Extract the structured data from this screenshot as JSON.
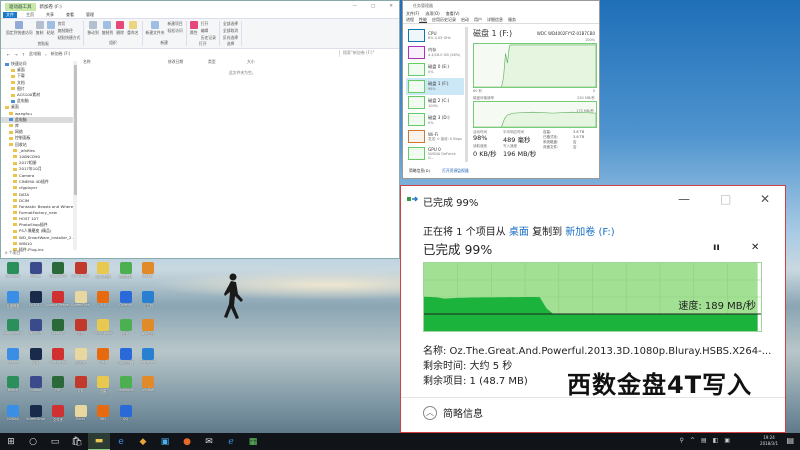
{
  "explorer": {
    "context_tab": "驱动器工具",
    "title": "新加卷 (F:)",
    "tabs": [
      "文件",
      "主页",
      "共享",
      "查看",
      "管理"
    ],
    "ribbon_groups": [
      {
        "name": "剪贴板",
        "buttons": [
          "固定到快速访问",
          "复制",
          "粘贴"
        ],
        "small": [
          "剪切",
          "复制路径",
          "粘贴快捷方式"
        ]
      },
      {
        "name": "组织",
        "buttons": [
          "移动到",
          "复制到",
          "删除",
          "重命名"
        ],
        "small": []
      },
      {
        "name": "新建",
        "buttons": [
          "新建文件夹"
        ],
        "small": [
          "新建项目",
          "轻松访问"
        ]
      },
      {
        "name": "打开",
        "buttons": [
          "属性"
        ],
        "small": [
          "打开",
          "编辑",
          "历史记录"
        ]
      },
      {
        "name": "选择",
        "buttons": [],
        "small": [
          "全部选择",
          "全部取消",
          "反向选择"
        ]
      }
    ],
    "address": [
      "此电脑",
      "新加卷 (F:)"
    ],
    "search_placeholder": "搜索\"新加卷 (F:)\"",
    "columns": [
      "名称",
      "修改日期",
      "类型",
      "大小"
    ],
    "empty_text": "此文件夹为空。",
    "tree": [
      "快速访问",
      "桌面",
      "下载",
      "文档",
      "图片",
      "ACS100素材",
      "此电脑",
      "桌面",
      "wangfuu",
      "此电脑",
      "库",
      "网络",
      "控制面板",
      "回收站",
      "_afxfiles",
      "100NCD90",
      "2017相册",
      "2017年10月",
      "Camera",
      "CINEMA 4D插件",
      "cfgplayer",
      "DATA",
      "DCIM",
      "Fantastic Beasts and Where to Fi",
      "FormatFactory_new",
      "HOST 10T",
      "PhotoShop插件",
      "PS人像磨皮 (精品)",
      "WD_SmartWare_Installer_2.4.20",
      "WIN10",
      "插件-Plug-ins"
    ],
    "status": "0 个项目"
  },
  "taskmgr": {
    "title": "任务管理器",
    "menu": [
      "文件(F)",
      "选项(O)",
      "查看(V)"
    ],
    "tabs": [
      "进程",
      "性能",
      "应用历史记录",
      "启动",
      "用户",
      "详细信息",
      "服务"
    ],
    "list": [
      {
        "name": "CPU",
        "value": "6% 4.05 GHz"
      },
      {
        "name": "内存",
        "value": "4.4/16.0 GB (28%)"
      },
      {
        "name": "磁盘 0 (E:)",
        "value": "0%"
      },
      {
        "name": "磁盘 1 (F:)",
        "value": "98%"
      },
      {
        "name": "磁盘 2 (C:)",
        "value": "100%"
      },
      {
        "name": "磁盘 3 (D:)",
        "value": "0%"
      },
      {
        "name": "Wi-Fi",
        "value": "发送: 0 接收: 0 Kbps"
      },
      {
        "name": "GPU 0",
        "value": "NVIDIA GeForce G..."
      }
    ],
    "disk_title": "磁盘 1 (F:)",
    "disk_model": "WDC WD4002FYYZ-01B7CB0",
    "graph1_top": "100%",
    "graph1_left": "60 秒",
    "graph1_right": "0",
    "graph2_label": "磁盘传输速率",
    "graph2_top": "250 MB/秒",
    "graph2_mid": "175 MB/秒",
    "stats": {
      "active_label": "活动时间",
      "active": "98%",
      "resp_label": "平均响应时间",
      "resp": "489 毫秒",
      "read_label": "读取速度",
      "read": "0 KB/秒",
      "write_label": "写入速度",
      "write": "196 MB/秒"
    },
    "props": [
      [
        "容量:",
        "3.6 TB"
      ],
      [
        "已格式化:",
        "3.6 TB"
      ],
      [
        "系统磁盘:",
        "否"
      ],
      [
        "页面文件:",
        "否"
      ]
    ],
    "footer": [
      "简略信息(D)",
      "打开资源监视器"
    ]
  },
  "dialog": {
    "title": "已完成 99%",
    "line_prefix": "正在将 1 个项目从",
    "source": "桌面",
    "line_mid": "复制到",
    "dest": "新加卷 (F:)",
    "progress_text": "已完成 99%",
    "progress": 0.99,
    "speed_label": "速度: 189 MB/秒",
    "name_line": "名称: Oz.The.Great.And.Powerful.2013.3D.1080p.Bluray.HSBS.X264-...",
    "time_line": "剩余时间: 大约 5 秒",
    "items_line": "剩余项目: 1 (48.7 MB)",
    "watermark": "西数金盘4T写入",
    "less_details": "简略信息",
    "speed_max": 756,
    "speed_history": [
      380,
      378,
      372,
      360,
      365,
      368,
      370,
      372,
      372,
      373,
      374,
      375,
      376,
      377,
      377,
      378,
      378,
      377,
      250,
      189,
      189,
      189,
      192,
      194,
      192,
      190,
      189,
      189,
      188,
      189,
      189,
      189,
      188,
      189,
      189,
      189,
      189,
      189,
      189,
      189,
      189,
      189,
      189,
      189,
      189,
      189,
      189,
      189,
      189,
      189
    ]
  },
  "desktop_icons": [
    "Sunlogin",
    "Adobe",
    "OpenALPR",
    "AnvilFusion",
    "2017拍摄",
    "数据恢复",
    "Jabber",
    "百度网盘",
    "Lr 2017",
    "Adobe Reader",
    "ScreenFlow",
    "VLC",
    "Cinema",
    "小工具",
    "sample.xlsx",
    "WinRAR",
    "ExitLAG",
    "文档",
    "OBS Studio",
    "云盘",
    "审计工作",
    "Beaver",
    "百度",
    "Photoshop",
    "文件夹",
    "Foxit",
    "QQ浏览器",
    "cfgplayer",
    "Beach",
    "Outlook",
    "PDF",
    "文件",
    "迅雷",
    "FastStone",
    "WinRAR",
    "NVIDIA",
    "ScreenShot",
    "文件夹",
    "Excel",
    "WD",
    "QQ"
  ],
  "taskbar": {
    "time": "19:24",
    "date": "2018/3/1"
  }
}
